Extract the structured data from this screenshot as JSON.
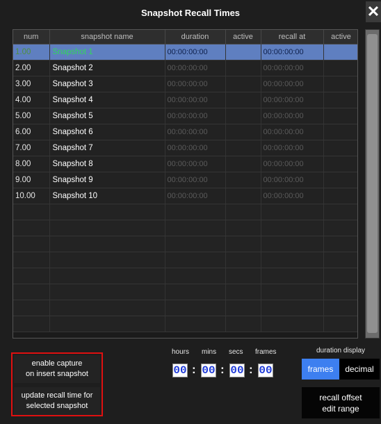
{
  "window": {
    "title": "Snapshot Recall Times",
    "close_label": "✕"
  },
  "table": {
    "headers": [
      "num",
      "snapshot name",
      "duration",
      "active",
      "recall at",
      "active"
    ],
    "rows": [
      {
        "num": "1.00",
        "name": "Snapshot 1",
        "duration": "00:00:00:00",
        "active": "",
        "recall_at": "00:00:00:00",
        "active2": ""
      },
      {
        "num": "2.00",
        "name": "Snapshot 2",
        "duration": "00:00:00:00",
        "active": "",
        "recall_at": "00:00:00:00",
        "active2": ""
      },
      {
        "num": "3.00",
        "name": "Snapshot 3",
        "duration": "00:00:00:00",
        "active": "",
        "recall_at": "00:00:00:00",
        "active2": ""
      },
      {
        "num": "4.00",
        "name": "Snapshot 4",
        "duration": "00:00:00:00",
        "active": "",
        "recall_at": "00:00:00:00",
        "active2": ""
      },
      {
        "num": "5.00",
        "name": "Snapshot 5",
        "duration": "00:00:00:00",
        "active": "",
        "recall_at": "00:00:00:00",
        "active2": ""
      },
      {
        "num": "6.00",
        "name": "Snapshot 6",
        "duration": "00:00:00:00",
        "active": "",
        "recall_at": "00:00:00:00",
        "active2": ""
      },
      {
        "num": "7.00",
        "name": "Snapshot 7",
        "duration": "00:00:00:00",
        "active": "",
        "recall_at": "00:00:00:00",
        "active2": ""
      },
      {
        "num": "8.00",
        "name": "Snapshot 8",
        "duration": "00:00:00:00",
        "active": "",
        "recall_at": "00:00:00:00",
        "active2": ""
      },
      {
        "num": "9.00",
        "name": "Snapshot 9",
        "duration": "00:00:00:00",
        "active": "",
        "recall_at": "00:00:00:00",
        "active2": ""
      },
      {
        "num": "10.00",
        "name": "Snapshot 10",
        "duration": "00:00:00:00",
        "active": "",
        "recall_at": "00:00:00:00",
        "active2": ""
      }
    ],
    "empty_rows": 8
  },
  "buttons": {
    "enable_capture": "enable capture\non insert snapshot",
    "update_recall": "update recall time for\nselected snapshot"
  },
  "time_entry": {
    "labels": {
      "hours": "hours",
      "mins": "mins",
      "secs": "secs",
      "frames": "frames"
    },
    "values": {
      "hours": "00",
      "mins": "00",
      "secs": "00",
      "frames": "00"
    },
    "separator": ":"
  },
  "duration_display": {
    "label": "duration display",
    "options": [
      "frames",
      "decimal"
    ],
    "selected": "frames"
  },
  "recall_offset_button": "recall offset\nedit range",
  "colors": {
    "background": "#1e1e1e",
    "selected_row": "#5f7fc0",
    "selected_name": "#32d65c",
    "highlight_border": "#e01010",
    "active_segment": "#3d7ff0",
    "time_digits": "#1e3ad8"
  }
}
